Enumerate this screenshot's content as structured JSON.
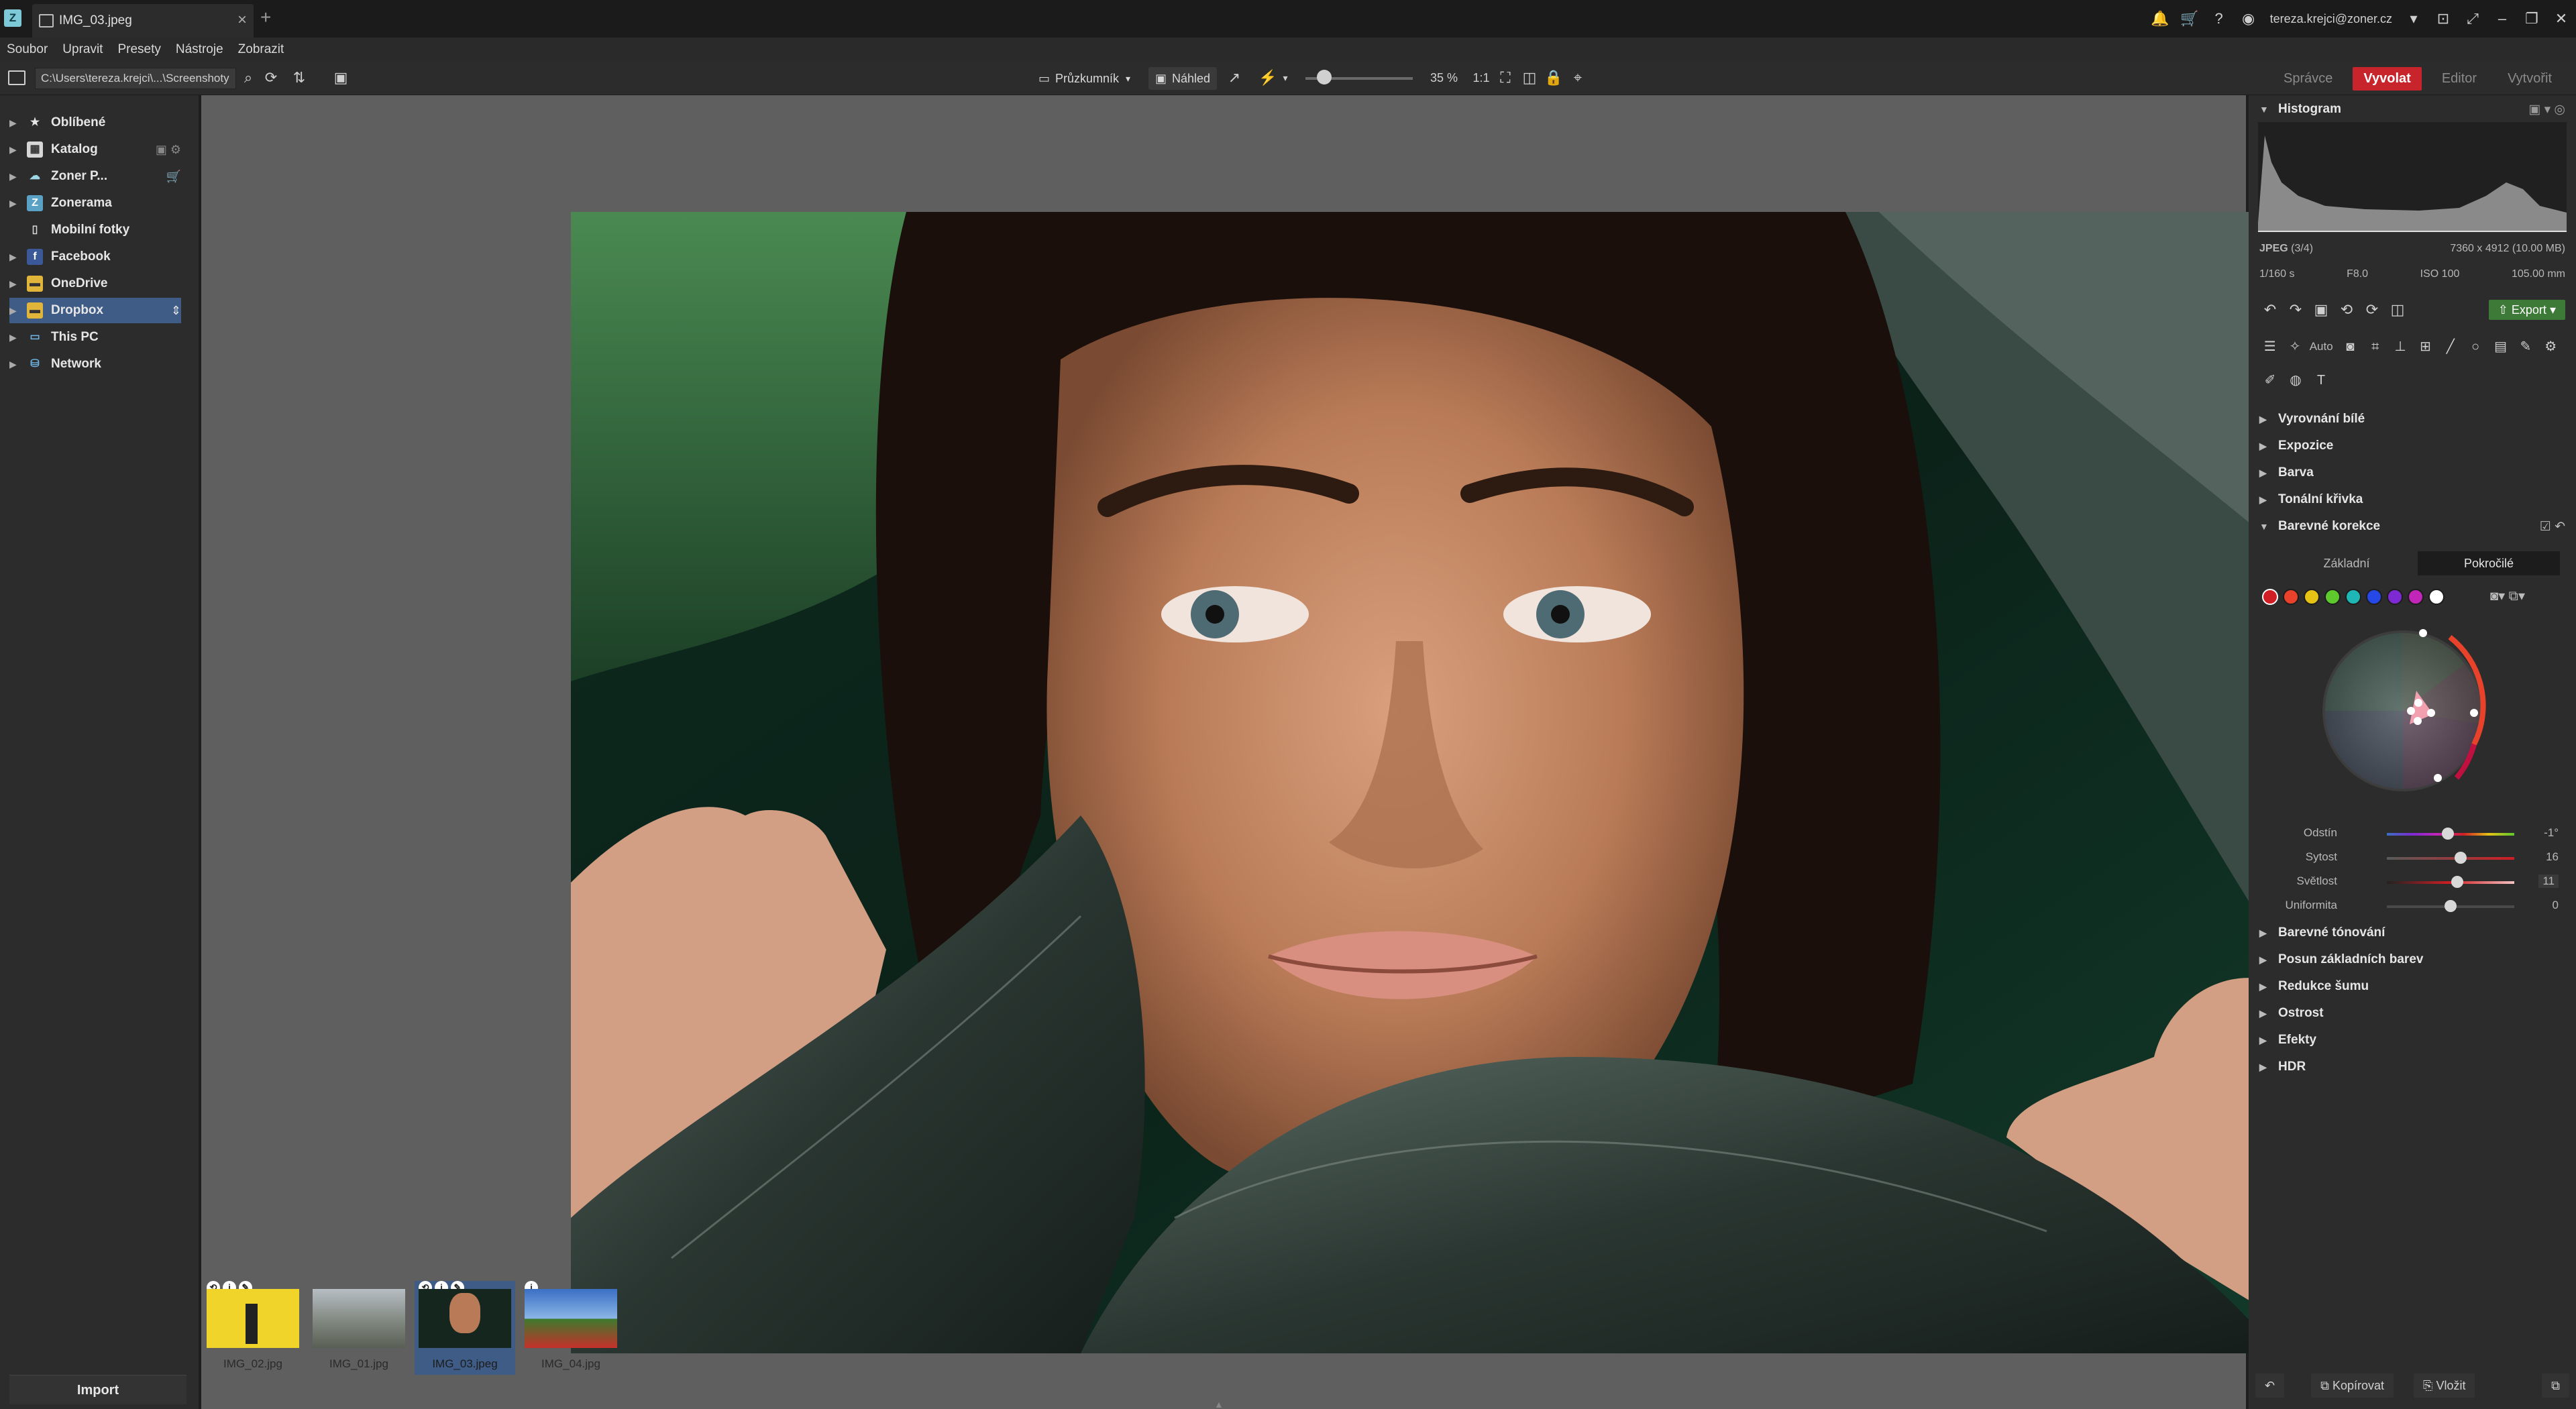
{
  "titlebar": {
    "tab_title": "IMG_03.jpeg",
    "user_email": "tereza.krejci@zoner.cz"
  },
  "menu": [
    "Soubor",
    "Upravit",
    "Presety",
    "Nástroje",
    "Zobrazit"
  ],
  "toolbar": {
    "path": "C:\\Users\\tereza.krejci\\...\\Screenshoty",
    "explorer_label": "Průzkumník",
    "preview_label": "Náhled",
    "zoom": 35,
    "zoom_text": "35 %",
    "modes": [
      "Správce",
      "Vyvolat",
      "Editor",
      "Vytvořit"
    ],
    "active_mode": "Vyvolat"
  },
  "navigator": {
    "items": [
      {
        "label": "Oblíbené",
        "icon": "star-icon"
      },
      {
        "label": "Katalog",
        "icon": "catalog-icon"
      },
      {
        "label": "Zoner P...",
        "icon": "cloud-icon"
      },
      {
        "label": "Zonerama",
        "icon": "zonerama-icon"
      },
      {
        "label": "Mobilní fotky",
        "icon": "mobile-icon"
      },
      {
        "label": "Facebook",
        "icon": "facebook-icon"
      },
      {
        "label": "OneDrive",
        "icon": "onedrive-icon"
      },
      {
        "label": "Dropbox",
        "icon": "dropbox-icon"
      },
      {
        "label": "This PC",
        "icon": "computer-icon"
      },
      {
        "label": "Network",
        "icon": "network-icon"
      }
    ],
    "selected": "Dropbox",
    "import_label": "Import"
  },
  "filmstrip": [
    {
      "label": "IMG_02.jpg",
      "selected": false
    },
    {
      "label": "IMG_01.jpg",
      "selected": false
    },
    {
      "label": "IMG_03.jpeg",
      "selected": true
    },
    {
      "label": "IMG_04.jpg",
      "selected": false
    }
  ],
  "right_panel": {
    "histogram_title": "Histogram",
    "file_type": "JPEG",
    "file_index": "(3/4)",
    "dimensions": "7360 x 4912 (10.00 MB)",
    "shutter": "1/160 s",
    "aperture": "F8.0",
    "iso": "ISO 100",
    "focal": "105.00 mm",
    "export_label": "Export",
    "auto_label": "Auto",
    "sections_top": [
      "Vyrovnání bílé",
      "Expozice",
      "Barva",
      "Tonální křivka"
    ],
    "open_section": "Barevné korekce",
    "subtabs": [
      "Základní",
      "Pokročilé"
    ],
    "active_subtab": "Pokročilé",
    "swatch_colors": [
      "#d01e24",
      "#e8432a",
      "#e6c215",
      "#5dc92c",
      "#1fb7b5",
      "#2548e6",
      "#7d2ad2",
      "#c126b8",
      "#ffffff"
    ],
    "sliders": [
      {
        "label": "Odstín",
        "value": "-1°",
        "level": 0.48
      },
      {
        "label": "Sytost",
        "value": "16",
        "level": 0.58
      },
      {
        "label": "Světlost",
        "value": "11",
        "level": 0.55
      },
      {
        "label": "Uniformita",
        "value": "0",
        "level": 0.5
      }
    ],
    "sections_bottom": [
      "Barevné tónování",
      "Posun základních barev",
      "Redukce šumu",
      "Ostrost",
      "Efekty",
      "HDR"
    ],
    "copy_label": "Kopírovat",
    "paste_label": "Vložit"
  }
}
